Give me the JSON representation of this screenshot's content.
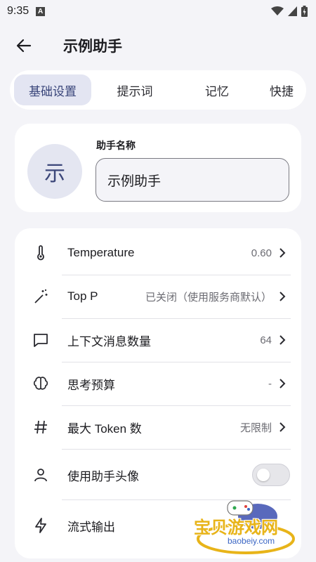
{
  "status_bar": {
    "time": "9:35",
    "notification_icon": "A"
  },
  "header": {
    "title": "示例助手"
  },
  "tabs": [
    {
      "label": "基础设置",
      "active": true
    },
    {
      "label": "提示词",
      "active": false
    },
    {
      "label": "记忆",
      "active": false
    },
    {
      "label": "快捷",
      "active": false
    }
  ],
  "assistant": {
    "avatar_text": "示",
    "name_label": "助手名称",
    "name_value": "示例助手"
  },
  "settings": [
    {
      "icon": "thermometer-icon",
      "label": "Temperature",
      "value": "0.60"
    },
    {
      "icon": "magic-wand-icon",
      "label": "Top P",
      "value": "已关闭（使用服务商默认）"
    },
    {
      "icon": "chat-bubble-icon",
      "label": "上下文消息数量",
      "value": "64"
    },
    {
      "icon": "brain-icon",
      "label": "思考预算",
      "value": "-"
    },
    {
      "icon": "hash-icon",
      "label": "最大 Token 数",
      "value": "无限制"
    },
    {
      "icon": "person-icon",
      "label": "使用助手头像",
      "toggle": false
    },
    {
      "icon": "lightning-icon",
      "label": "流式输出"
    }
  ],
  "watermark": {
    "text": "宝贝游戏网",
    "url": "baobeiy.com"
  },
  "colors": {
    "accent": "#39457a",
    "tab_active_bg": "#e3e5f2",
    "background": "#f4f4f8",
    "watermark": "#e8b419"
  }
}
